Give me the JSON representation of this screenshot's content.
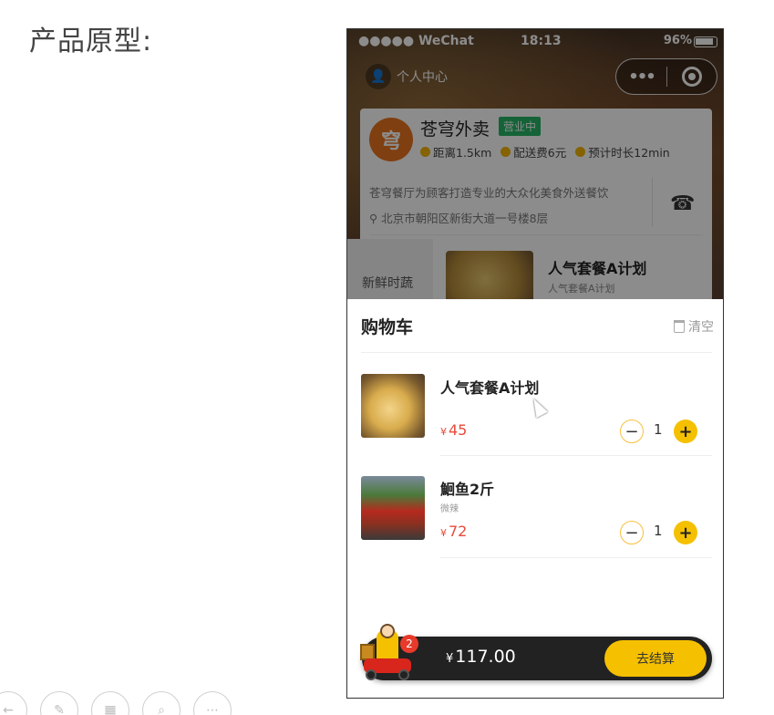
{
  "slide": {
    "title": "产品原型:"
  },
  "status_bar": {
    "carrier": "●●●●● WeChat",
    "time": "18:13",
    "battery": "96%"
  },
  "nav": {
    "profile_label": "个人中心",
    "more_glyph": "•••"
  },
  "store": {
    "logo_char": "穹",
    "name": "苍穹外卖",
    "status_badge": "营业中",
    "distance": "距离1.5km",
    "delivery_fee": "配送费6元",
    "eta": "预计时长12min",
    "description": "苍穹餐厅为顾客打造专业的大众化美食外送餐饮",
    "address": "北京市朝阳区新街大道一号楼8层"
  },
  "menu_peek": {
    "category": "新鲜时蔬",
    "dish_title": "人气套餐A计划",
    "dish_sub": "人气套餐A计划"
  },
  "cart": {
    "title": "购物车",
    "clear_label": "清空",
    "items": [
      {
        "name": "人气套餐A计划",
        "tag": "",
        "currency": "¥",
        "price": "45",
        "qty": "1",
        "minus": "−",
        "plus": "+"
      },
      {
        "name": "鮰鱼2斤",
        "tag": "微辣",
        "currency": "¥",
        "price": "72",
        "qty": "1",
        "minus": "−",
        "plus": "+"
      }
    ]
  },
  "checkout": {
    "badge_count": "2",
    "currency": "¥",
    "total": "117.00",
    "button_label": "去结算"
  },
  "colors": {
    "accent": "#f5c000",
    "price": "#e84a3a",
    "badge_green": "#27b566",
    "dark": "#222222"
  }
}
